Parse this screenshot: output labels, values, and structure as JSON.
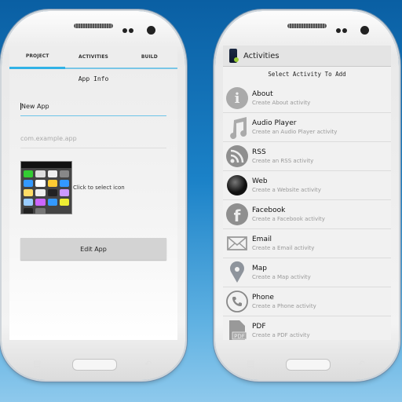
{
  "left_phone": {
    "tabs": [
      {
        "label": "PROJECT",
        "active": true
      },
      {
        "label": "ACTIVITIES",
        "active": false
      },
      {
        "label": "BUILD",
        "active": false
      }
    ],
    "section_title": "App Info",
    "app_name_value": "New App",
    "package_placeholder": "com.example.app",
    "icon_label": "Click to select icon",
    "edit_button": "Edit App",
    "accent_color": "#31b2e6"
  },
  "right_phone": {
    "action_bar_title": "Activities",
    "list_header": "Select Activity To Add",
    "activities": [
      {
        "title": "About",
        "subtitle": "Create About activity",
        "icon": "info-icon"
      },
      {
        "title": "Audio Player",
        "subtitle": "Create an Audio Player activity",
        "icon": "music-note-icon"
      },
      {
        "title": "RSS",
        "subtitle": "Create an RSS activity",
        "icon": "rss-icon"
      },
      {
        "title": "Web",
        "subtitle": "Create a Website activity",
        "icon": "globe-icon"
      },
      {
        "title": "Facebook",
        "subtitle": "Create a Facebook activity",
        "icon": "facebook-icon"
      },
      {
        "title": "Email",
        "subtitle": "Create a Email activity",
        "icon": "envelope-icon"
      },
      {
        "title": "Map",
        "subtitle": "Create a Map activity",
        "icon": "map-pin-icon"
      },
      {
        "title": "Phone",
        "subtitle": "Create a Phone activity",
        "icon": "phone-icon"
      },
      {
        "title": "PDF",
        "subtitle": "Create a PDF activity",
        "icon": "pdf-icon"
      }
    ]
  }
}
